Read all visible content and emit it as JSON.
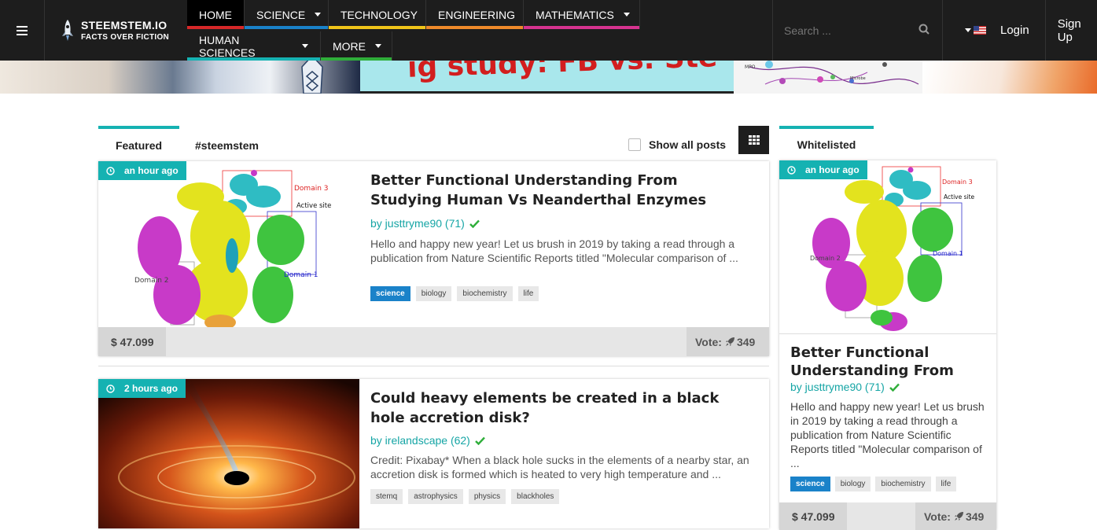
{
  "brand": {
    "name": "STEEMSTEM.IO",
    "tagline": "FACTS OVER FICTION"
  },
  "nav": {
    "row1": [
      {
        "label": "HOME",
        "color": "#d62728",
        "active": true
      },
      {
        "label": "SCIENCE",
        "color": "#1a82c9",
        "caret": true
      },
      {
        "label": "TECHNOLOGY",
        "color": "#f0c419"
      },
      {
        "label": "ENGINEERING",
        "color": "#ef8a2a"
      },
      {
        "label": "MATHEMATICS",
        "color": "#d6338f",
        "caret": true
      }
    ],
    "row2": [
      {
        "label": "HUMAN SCIENCES",
        "color": "#15b2b2",
        "caret": true
      },
      {
        "label": "MORE",
        "color": "#2fae3a",
        "caret": true
      }
    ]
  },
  "search": {
    "placeholder": "Search ..."
  },
  "user": {
    "login": "Login",
    "signup": "Sign Up"
  },
  "banner": {
    "text": "ig study: FB vs. Ste"
  },
  "tabs": {
    "featured": "Featured",
    "tag": "#steemstem",
    "show_all": "Show all posts"
  },
  "posts": [
    {
      "time": "an hour ago",
      "title": "Better Functional Understanding From Studying Human Vs Neanderthal Enzymes",
      "author": "by justtryme90 (71)",
      "excerpt": "Hello and happy new year! Let us brush in 2019 by taking a read through a publication from Nature Scientific Reports titled \"Molecular comparison of ...",
      "tags": [
        "science",
        "biology",
        "biochemistry",
        "life"
      ],
      "payout": "$  47.099",
      "vote": "Vote:",
      "votes": "349",
      "image": {
        "labels": [
          "Domain 3",
          "Active site",
          "Domain 2",
          "Domain 1"
        ]
      }
    },
    {
      "time": "2 hours ago",
      "title": "Could heavy elements be created in a black hole accretion disk?",
      "author": "by irelandscape (62)",
      "excerpt": "Credit: Pixabay* When a black hole sucks in the elements of a nearby star, an accretion disk is formed which is heated to very high temperature and ...",
      "tags": [
        "stemq",
        "astrophysics",
        "physics",
        "blackholes"
      ]
    }
  ],
  "whitelisted": {
    "tab": "Whitelisted",
    "time": "an hour ago",
    "title": "Better Functional Understanding From",
    "author": "by justtryme90 (71)",
    "excerpt": "Hello and happy new year! Let us brush in 2019 by taking a read through a publication from Nature Scientific Reports titled \"Molecular comparison of ...",
    "tags": [
      "science",
      "biology",
      "biochemistry",
      "life"
    ],
    "payout": "$  47.099",
    "vote": "Vote:",
    "votes": "349",
    "image": {
      "labels": [
        "Domain 3",
        "Active site",
        "Domain 2",
        "Domain 1"
      ]
    }
  }
}
